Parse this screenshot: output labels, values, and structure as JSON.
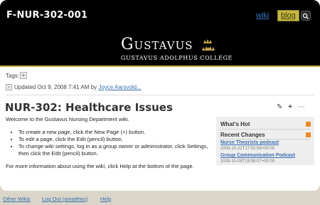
{
  "header": {
    "site_title": "F-NUR-302-001",
    "tabs": [
      {
        "label": "wiki"
      },
      {
        "label": "blog"
      }
    ],
    "search_icon": "search-icon"
  },
  "banner": {
    "logo_text": "Gustavus",
    "logo_sub": "GUSTAVUS ADOLPHUS COLLEGE"
  },
  "meta": {
    "tags_label": "Tags:",
    "updated_prefix": "Updated Oct 9, 2008 7:41 AM by",
    "updated_author": "Joyce Aarsvold..."
  },
  "page": {
    "title": "NUR-302: Healthcare Issues",
    "intro": "Welcome to the Gustavus Nursing Department wiki.",
    "bullets": [
      "To create a new page, click the New Page (+) button.",
      "To edit a page, click the Edit (pencil) button.",
      "To change wiki settings, log in as a group owner or administrator, click Settings, then click the Edit (pencil) button."
    ],
    "help_text": "For more information about using the wiki, click Help at the bottom of the page."
  },
  "sidebar": {
    "whats_hot": "What's Hot",
    "recent_changes": "Recent Changes",
    "posts": [
      {
        "title": "Nurse Theorists podcast",
        "date": "2008-10-22T17:02:58+00:00"
      },
      {
        "title": "Group Communication Podcast",
        "date": "2008-10-08T19:58:07+00:00"
      }
    ]
  },
  "footer": {
    "links": [
      {
        "label": "Other Wikis"
      },
      {
        "label": "Log Out (amatthes)"
      },
      {
        "label": "Help"
      }
    ]
  }
}
